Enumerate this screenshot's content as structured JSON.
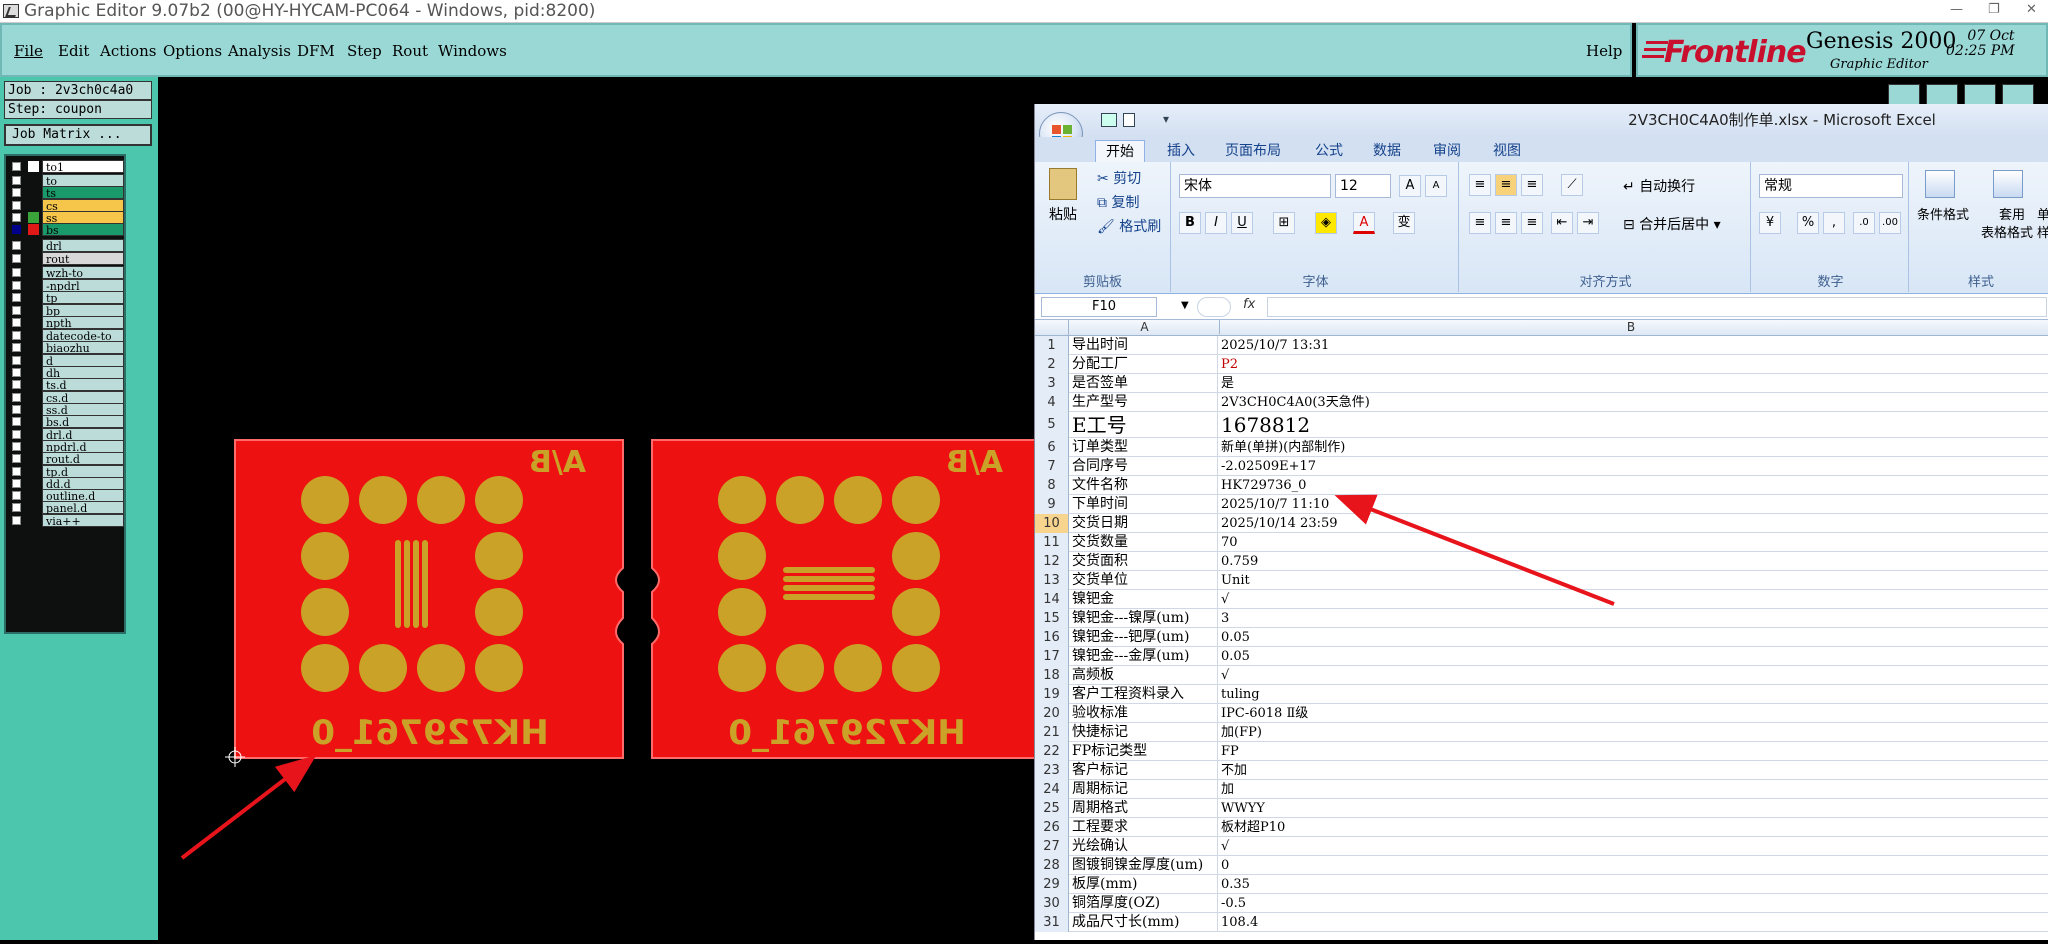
{
  "window": {
    "title": "Graphic Editor 9.07b2 (00@HY-HYCAM-PC064 - Windows, pid:8200)"
  },
  "genesis": {
    "menu": [
      "File",
      "Edit",
      "Actions",
      "Options",
      "Analysis",
      "DFM",
      "Step",
      "Rout",
      "Windows"
    ],
    "help": "Help",
    "brand": {
      "logo": "Frontline",
      "product": "Genesis 2000",
      "subtitle": "Graphic Editor",
      "date": "07 Oct",
      "time": "02:25 PM"
    },
    "job_label": "Job : 2v3ch0c4a0",
    "step_label": "Step: coupon",
    "job_matrix_button": "Job Matrix ...",
    "layers": [
      {
        "name": "to1",
        "color": "#ffffff",
        "bg": "#ffffff",
        "checked": false
      },
      {
        "name": "to",
        "color": "#0e1010",
        "bg": "#bcdcda",
        "checked": false
      },
      {
        "name": "ts",
        "color": "#0e1010",
        "bg": "#1a9a6a",
        "checked": false
      },
      {
        "name": "cs",
        "color": "#0e1010",
        "bg": "#f5c64a",
        "checked": false
      },
      {
        "name": "ss",
        "color": "#3aa43a",
        "bg": "#f5c64a",
        "checked": false
      },
      {
        "name": "bs",
        "color": "#e01818",
        "bg": "#1a9a6a",
        "checked": true
      },
      {
        "name": "drl",
        "color": "#0e1010",
        "bg": "#bcdcda",
        "checked": false
      },
      {
        "name": "rout",
        "color": "#0e1010",
        "bg": "#d8d8d8",
        "checked": false
      },
      {
        "name": "wzh-to",
        "color": "#0e1010",
        "bg": "#bcdcda",
        "checked": false
      },
      {
        "name": "-npdrl",
        "color": "#0e1010",
        "bg": "#bcdcda",
        "checked": false
      },
      {
        "name": "tp",
        "color": "#0e1010",
        "bg": "#bcdcda",
        "checked": false
      },
      {
        "name": "bp",
        "color": "#0e1010",
        "bg": "#bcdcda",
        "checked": false
      },
      {
        "name": "npth",
        "color": "#0e1010",
        "bg": "#bcdcda",
        "checked": false
      },
      {
        "name": "datecode-to",
        "color": "#0e1010",
        "bg": "#bcdcda",
        "checked": false
      },
      {
        "name": "biaozhu",
        "color": "#0e1010",
        "bg": "#bcdcda",
        "checked": false
      },
      {
        "name": "d",
        "color": "#0e1010",
        "bg": "#bcdcda",
        "checked": false
      },
      {
        "name": "dh",
        "color": "#0e1010",
        "bg": "#bcdcda",
        "checked": false
      },
      {
        "name": "ts.d",
        "color": "#0e1010",
        "bg": "#bcdcda",
        "checked": false
      },
      {
        "name": "cs.d",
        "color": "#0e1010",
        "bg": "#bcdcda",
        "checked": false
      },
      {
        "name": "ss.d",
        "color": "#0e1010",
        "bg": "#bcdcda",
        "checked": false
      },
      {
        "name": "bs.d",
        "color": "#0e1010",
        "bg": "#bcdcda",
        "checked": false
      },
      {
        "name": "drl.d",
        "color": "#0e1010",
        "bg": "#bcdcda",
        "checked": false
      },
      {
        "name": "npdrl.d",
        "color": "#0e1010",
        "bg": "#bcdcda",
        "checked": false
      },
      {
        "name": "rout.d",
        "color": "#0e1010",
        "bg": "#bcdcda",
        "checked": false
      },
      {
        "name": "tp.d",
        "color": "#0e1010",
        "bg": "#bcdcda",
        "checked": false
      },
      {
        "name": "dd.d",
        "color": "#0e1010",
        "bg": "#bcdcda",
        "checked": false
      },
      {
        "name": "outline.d",
        "color": "#0e1010",
        "bg": "#bcdcda",
        "checked": false
      },
      {
        "name": "panel.d",
        "color": "#0e1010",
        "bg": "#bcdcda",
        "checked": false
      },
      {
        "name": "via++",
        "color": "#0e1010",
        "bg": "#bcdcda",
        "checked": false
      }
    ],
    "board": {
      "corner_text": "A/B",
      "part_text": "HK729761_0",
      "colors": {
        "board": "#ee1111",
        "pad": "#c9a227",
        "outline": "#ff6a6a"
      }
    }
  },
  "excel": {
    "title": "2V3CH0C4A0制作单.xlsx - Microsoft Excel",
    "tabs": [
      "开始",
      "插入",
      "页面布局",
      "公式",
      "数据",
      "审阅",
      "视图"
    ],
    "ribbon": {
      "clipboard": {
        "paste": "粘贴",
        "cut": "剪切",
        "copy": "复制",
        "format_painter": "格式刷",
        "group": "剪贴板"
      },
      "font": {
        "name": "宋体",
        "size": "12",
        "group": "字体",
        "bold": "B",
        "italic": "I",
        "underline": "U",
        "color_a": "A",
        "wen": "变"
      },
      "align": {
        "wrap": "自动换行",
        "merge": "合并后居中",
        "group": "对齐方式"
      },
      "number": {
        "format": "常规",
        "group": "数字",
        "percent": "%",
        "comma": ","
      },
      "styles": {
        "conditional": "条件格式",
        "table_format_1": "套用",
        "table_format_2": "表格格式",
        "cell_style": "单",
        "cell_style_2": "样",
        "group": "样式"
      }
    },
    "namebox": "F10",
    "fx": "fx",
    "columns": [
      "A",
      "B"
    ],
    "rows": [
      {
        "n": "1",
        "a": "导出时间",
        "b": "2025/10/7 13:31"
      },
      {
        "n": "2",
        "a": "分配工厂",
        "b": "P2",
        "red": true
      },
      {
        "n": "3",
        "a": "是否签单",
        "b": "是"
      },
      {
        "n": "4",
        "a": "生产型号",
        "b": "2V3CH0C4A0(3天急件)"
      },
      {
        "n": "5",
        "a": "E工号",
        "b": "1678812",
        "big": true
      },
      {
        "n": "6",
        "a": "订单类型",
        "b": "新单(单拼)(内部制作)"
      },
      {
        "n": "7",
        "a": "合同序号",
        "b": "-2.02509E+17"
      },
      {
        "n": "8",
        "a": "文件名称",
        "b": "HK729736_0"
      },
      {
        "n": "9",
        "a": "下单时间",
        "b": "2025/10/7 11:10"
      },
      {
        "n": "10",
        "a": "交货日期",
        "b": "2025/10/14 23:59",
        "sel": true
      },
      {
        "n": "11",
        "a": "交货数量",
        "b": "70"
      },
      {
        "n": "12",
        "a": "交货面积",
        "b": "0.759"
      },
      {
        "n": "13",
        "a": "交货单位",
        "b": "Unit"
      },
      {
        "n": "14",
        "a": "镍钯金",
        "b": "√"
      },
      {
        "n": "15",
        "a": "镍钯金---镍厚(um)",
        "b": "3"
      },
      {
        "n": "16",
        "a": "镍钯金---钯厚(um)",
        "b": "0.05"
      },
      {
        "n": "17",
        "a": "镍钯金---金厚(um)",
        "b": "0.05"
      },
      {
        "n": "18",
        "a": "高频板",
        "b": "√"
      },
      {
        "n": "19",
        "a": "客户工程资料录入",
        "b": "tuling"
      },
      {
        "n": "20",
        "a": "验收标准",
        "b": "IPC-6018 Ⅱ级"
      },
      {
        "n": "21",
        "a": "快捷标记",
        "b": "加(FP)"
      },
      {
        "n": "22",
        "a": "FP标记类型",
        "b": "FP"
      },
      {
        "n": "23",
        "a": "客户标记",
        "b": "不加"
      },
      {
        "n": "24",
        "a": "周期标记",
        "b": "加"
      },
      {
        "n": "25",
        "a": "周期格式",
        "b": "WWYY"
      },
      {
        "n": "26",
        "a": "工程要求",
        "b": "板材超P10"
      },
      {
        "n": "27",
        "a": "光绘确认",
        "b": "√"
      },
      {
        "n": "28",
        "a": "图镀铜镍金厚度(um)",
        "b": "0"
      },
      {
        "n": "29",
        "a": "板厚(mm)",
        "b": "0.35"
      },
      {
        "n": "30",
        "a": "铜箔厚度(OZ)",
        "b": "-0.5"
      },
      {
        "n": "31",
        "a": "成品尺寸长(mm)",
        "b": "108.4"
      }
    ]
  },
  "annotation": {
    "arrow_color": "#e8141c"
  }
}
